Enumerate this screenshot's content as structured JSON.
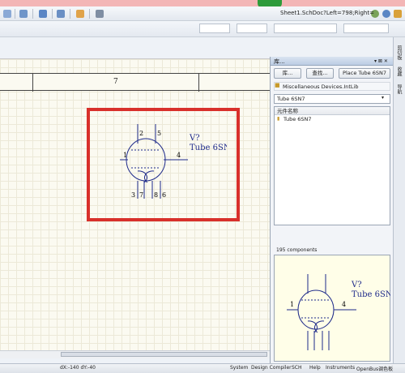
{
  "window": {
    "document_path": "Sheet1.SchDoc?Left=798;Right="
  },
  "canvas": {
    "zone_number": "7"
  },
  "symbol": {
    "designator": "V?",
    "comment": "Tube 6SN7",
    "pins": [
      "1",
      "2",
      "3",
      "4",
      "5",
      "6",
      "7",
      "8"
    ]
  },
  "library_panel": {
    "title": "库...",
    "buttons": {
      "libraries": "库...",
      "search": "查找...",
      "place": "Place Tube 6SN7"
    },
    "selected_library": "Miscellaneous Devices.IntLib",
    "filter_value": "Tube 6SN7",
    "column_header": "元件名称",
    "components": [
      "Tube 6SN7"
    ],
    "component_count": "195 components"
  },
  "side_tabs": [
    "剪切板",
    "收藏",
    "导航"
  ],
  "status": {
    "coordinates": "dX:-140 dY:-40",
    "tabs": [
      "System",
      "Design Compiler",
      "SCH",
      "Help",
      "Instruments",
      "OpenBus调色板"
    ]
  },
  "colors": {
    "highlight_box": "#d8302b",
    "symbol_stroke": "#1e2a8a"
  }
}
